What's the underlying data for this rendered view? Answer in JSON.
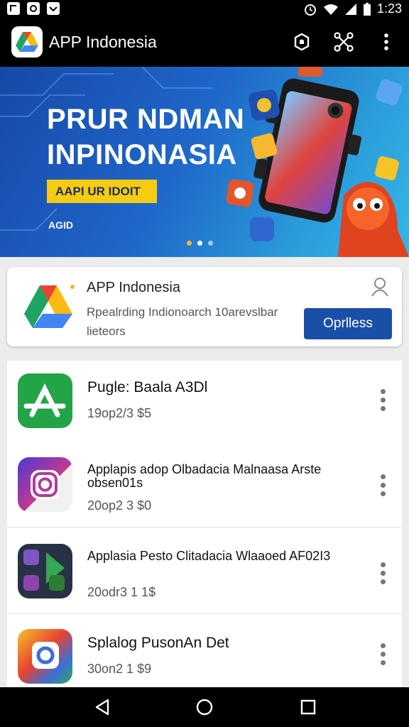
{
  "status_bar": {
    "time": "1:23"
  },
  "app_bar": {
    "title": "APP Indonesia"
  },
  "banner": {
    "headline_1": "PRUR NDMAN",
    "headline_2": "INPINONASIA",
    "cta": "AAPI UR IDOIT",
    "small_text": "AGID"
  },
  "featured": {
    "title": "APP Indonesia",
    "description": "Rpealrding Indionoarch 10arevslbar lieteors",
    "button": "Oprlless"
  },
  "apps": [
    {
      "title": "Pugle: Baala A3Dl",
      "meta": "19op2/3 $5"
    },
    {
      "title": "Applapis adop Olbadacia Malnaasa Arste obsen01s",
      "meta": "20op2 3 $0"
    },
    {
      "title": "Applasia Pesto Clitadacia Wlaaoed AF02I3",
      "meta": "20odr3 1 1$"
    },
    {
      "title": "Splalog PusonAn Det",
      "meta": "30on2 1 $9"
    }
  ],
  "colors": {
    "accent": "#1a4fa8",
    "banner_cta": "#f5cc12"
  }
}
